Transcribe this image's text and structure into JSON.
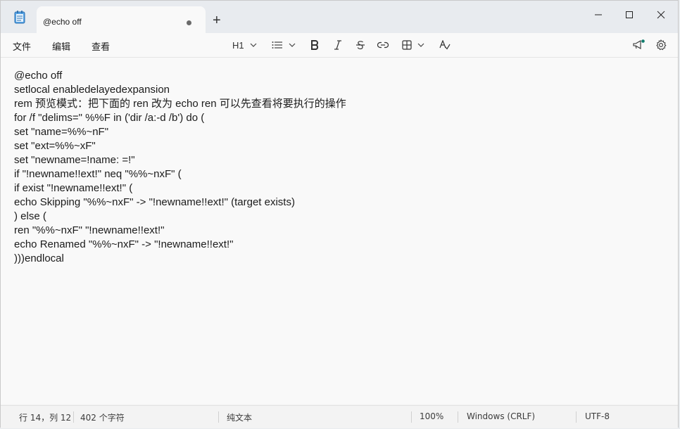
{
  "tab": {
    "title": "@echo off",
    "new_tab": "+"
  },
  "menu": {
    "file": "文件",
    "edit": "编辑",
    "view": "查看"
  },
  "toolbar": {
    "heading": "H1"
  },
  "editor": {
    "lines": [
      "@echo off",
      "setlocal enabledelayedexpansion",
      "rem 预览模式：把下面的 ren 改为 echo ren 可以先查看将要执行的操作",
      "for /f \"delims=\" %%F in ('dir /a:-d /b') do (",
      "set \"name=%%~nF\"",
      "set \"ext=%%~xF\"",
      "set \"newname=!name: =!\"",
      "if \"!newname!!ext!\" neq \"%%~nxF\" (",
      "if exist \"!newname!!ext!\" (",
      "echo Skipping \"%%~nxF\" -> \"!newname!!ext!\" (target exists)",
      ") else (",
      "ren \"%%~nxF\" \"!newname!!ext!\"",
      "echo Renamed \"%%~nxF\" -> \"!newname!!ext!\"",
      ")))endlocal"
    ]
  },
  "status": {
    "position": "行 14，列 12",
    "chars": "402 个字符",
    "format": "纯文本",
    "zoom": "100%",
    "line_ending": "Windows (CRLF)",
    "encoding": "UTF-8"
  },
  "colors": {
    "accent": "#0f7b6c",
    "notify_dot": "#0f7b6c"
  }
}
